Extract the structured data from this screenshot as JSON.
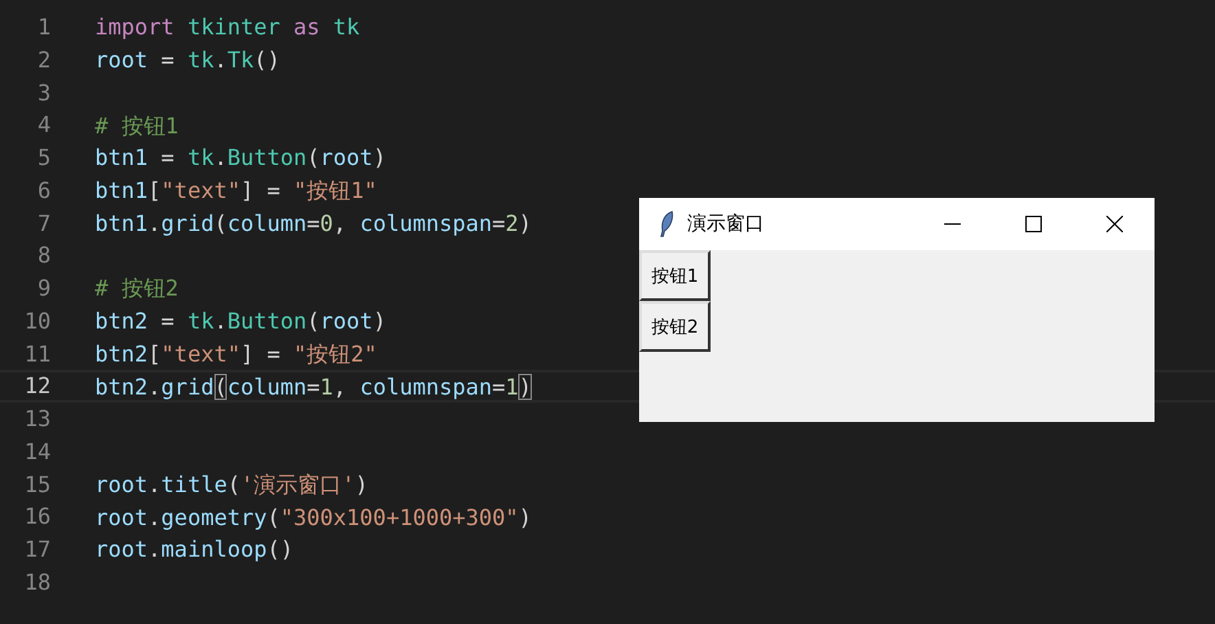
{
  "editor": {
    "lines": [
      {
        "number": "1",
        "current": false,
        "tokens": [
          {
            "text": "import ",
            "kind": "keyword"
          },
          {
            "text": "tkinter ",
            "kind": "class"
          },
          {
            "text": "as ",
            "kind": "keyword"
          },
          {
            "text": "tk",
            "kind": "class"
          }
        ]
      },
      {
        "number": "2",
        "current": false,
        "tokens": [
          {
            "text": "root",
            "kind": "variable"
          },
          {
            "text": " = ",
            "kind": "plain"
          },
          {
            "text": "tk",
            "kind": "class"
          },
          {
            "text": ".",
            "kind": "plain"
          },
          {
            "text": "Tk",
            "kind": "class"
          },
          {
            "text": "()",
            "kind": "plain"
          }
        ]
      },
      {
        "number": "3",
        "current": false
      },
      {
        "number": "4",
        "current": false,
        "tokens": [
          {
            "text": "# 按钮1",
            "kind": "comment"
          }
        ]
      },
      {
        "number": "5",
        "current": false,
        "tokens": [
          {
            "text": "btn1",
            "kind": "variable"
          },
          {
            "text": " = ",
            "kind": "plain"
          },
          {
            "text": "tk",
            "kind": "class"
          },
          {
            "text": ".",
            "kind": "plain"
          },
          {
            "text": "Button",
            "kind": "class"
          },
          {
            "text": "(",
            "kind": "plain"
          },
          {
            "text": "root",
            "kind": "variable"
          },
          {
            "text": ")",
            "kind": "plain"
          }
        ]
      },
      {
        "number": "6",
        "current": false,
        "tokens": [
          {
            "text": "btn1",
            "kind": "variable"
          },
          {
            "text": "[",
            "kind": "plain"
          },
          {
            "text": "\"text\"",
            "kind": "string"
          },
          {
            "text": "] = ",
            "kind": "plain"
          },
          {
            "text": "\"按钮1\"",
            "kind": "string"
          }
        ]
      },
      {
        "number": "7",
        "current": false,
        "tokens": [
          {
            "text": "btn1",
            "kind": "variable"
          },
          {
            "text": ".",
            "kind": "plain"
          },
          {
            "text": "grid",
            "kind": "variable"
          },
          {
            "text": "(",
            "kind": "plain"
          },
          {
            "text": "column",
            "kind": "variable"
          },
          {
            "text": "=",
            "kind": "plain"
          },
          {
            "text": "0",
            "kind": "number"
          },
          {
            "text": ", ",
            "kind": "plain"
          },
          {
            "text": "columnspan",
            "kind": "variable"
          },
          {
            "text": "=",
            "kind": "plain"
          },
          {
            "text": "2",
            "kind": "number"
          },
          {
            "text": ")",
            "kind": "plain"
          }
        ]
      },
      {
        "number": "8",
        "current": false
      },
      {
        "number": "9",
        "current": false,
        "tokens": [
          {
            "text": "# 按钮2",
            "kind": "comment"
          }
        ]
      },
      {
        "number": "10",
        "current": false,
        "tokens": [
          {
            "text": "btn2",
            "kind": "variable"
          },
          {
            "text": " = ",
            "kind": "plain"
          },
          {
            "text": "tk",
            "kind": "class"
          },
          {
            "text": ".",
            "kind": "plain"
          },
          {
            "text": "Button",
            "kind": "class"
          },
          {
            "text": "(",
            "kind": "plain"
          },
          {
            "text": "root",
            "kind": "variable"
          },
          {
            "text": ")",
            "kind": "plain"
          }
        ]
      },
      {
        "number": "11",
        "current": false,
        "tokens": [
          {
            "text": "btn2",
            "kind": "variable"
          },
          {
            "text": "[",
            "kind": "plain"
          },
          {
            "text": "\"text\"",
            "kind": "string"
          },
          {
            "text": "] = ",
            "kind": "plain"
          },
          {
            "text": "\"按钮2\"",
            "kind": "string"
          }
        ]
      },
      {
        "number": "12",
        "current": true,
        "tokens": [
          {
            "text": "btn2",
            "kind": "variable"
          },
          {
            "text": ".",
            "kind": "plain"
          },
          {
            "text": "grid",
            "kind": "variable"
          },
          {
            "text": "(",
            "kind": "plain",
            "matched": true
          },
          {
            "text": "column",
            "kind": "variable"
          },
          {
            "text": "=",
            "kind": "plain"
          },
          {
            "text": "1",
            "kind": "number"
          },
          {
            "text": ", ",
            "kind": "plain"
          },
          {
            "text": "columnspan",
            "kind": "variable"
          },
          {
            "text": "=",
            "kind": "plain"
          },
          {
            "text": "1",
            "kind": "number"
          },
          {
            "text": ")",
            "kind": "plain",
            "matched": true
          }
        ]
      },
      {
        "number": "13",
        "current": false
      },
      {
        "number": "14",
        "current": false
      },
      {
        "number": "15",
        "current": false,
        "tokens": [
          {
            "text": "root",
            "kind": "variable"
          },
          {
            "text": ".",
            "kind": "plain"
          },
          {
            "text": "title",
            "kind": "variable"
          },
          {
            "text": "(",
            "kind": "plain"
          },
          {
            "text": "'演示窗口'",
            "kind": "string"
          },
          {
            "text": ")",
            "kind": "plain"
          }
        ]
      },
      {
        "number": "16",
        "current": false,
        "tokens": [
          {
            "text": "root",
            "kind": "variable"
          },
          {
            "text": ".",
            "kind": "plain"
          },
          {
            "text": "geometry",
            "kind": "variable"
          },
          {
            "text": "(",
            "kind": "plain"
          },
          {
            "text": "\"300x100+1000+300\"",
            "kind": "string"
          },
          {
            "text": ")",
            "kind": "plain"
          }
        ]
      },
      {
        "number": "17",
        "current": false,
        "tokens": [
          {
            "text": "root",
            "kind": "variable"
          },
          {
            "text": ".",
            "kind": "plain"
          },
          {
            "text": "mainloop",
            "kind": "variable"
          },
          {
            "text": "()",
            "kind": "plain"
          }
        ]
      },
      {
        "number": "18",
        "current": false
      }
    ]
  },
  "tk_window": {
    "title": "演示窗口",
    "buttons": [
      {
        "label": "按钮1"
      },
      {
        "label": "按钮2"
      }
    ]
  }
}
